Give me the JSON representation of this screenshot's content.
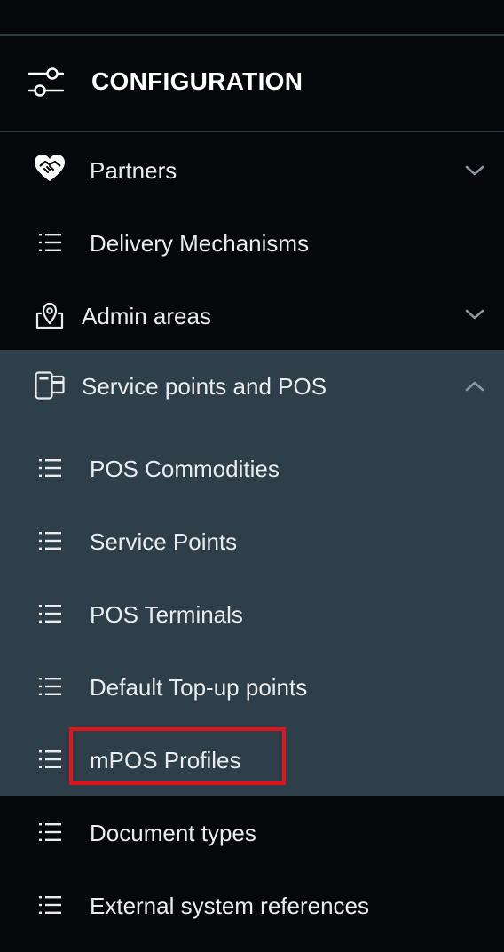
{
  "header": {
    "title": "CONFIGURATION",
    "icon": "sliders-icon"
  },
  "menu": {
    "partners": {
      "label": "Partners",
      "icon": "handshake-heart-icon",
      "expander": "chevron-down"
    },
    "delivery_mechanisms": {
      "label": "Delivery Mechanisms",
      "icon": "list-icon"
    },
    "admin_areas": {
      "label": "Admin areas",
      "icon": "map-pin-icon",
      "expander": "chevron-down"
    },
    "service_points": {
      "label": "Service points and POS",
      "icon": "pos-terminal-icon",
      "expander": "chevron-up",
      "expanded": true,
      "children": [
        {
          "label": "POS Commodities",
          "icon": "list-icon"
        },
        {
          "label": "Service Points",
          "icon": "list-icon"
        },
        {
          "label": "POS Terminals",
          "icon": "list-icon"
        },
        {
          "label": "Default Top-up points",
          "icon": "list-icon"
        },
        {
          "label": "mPOS Profiles",
          "icon": "list-icon",
          "highlighted": true
        }
      ]
    },
    "document_types": {
      "label": "Document types",
      "icon": "list-icon"
    },
    "external_refs": {
      "label": "External system references",
      "icon": "list-icon"
    }
  },
  "colors": {
    "background": "#05070b",
    "submenu_background": "#2f3f4a",
    "divider": "#2f3b44",
    "text": "#e8ecef",
    "highlight_border": "#e0141c"
  }
}
